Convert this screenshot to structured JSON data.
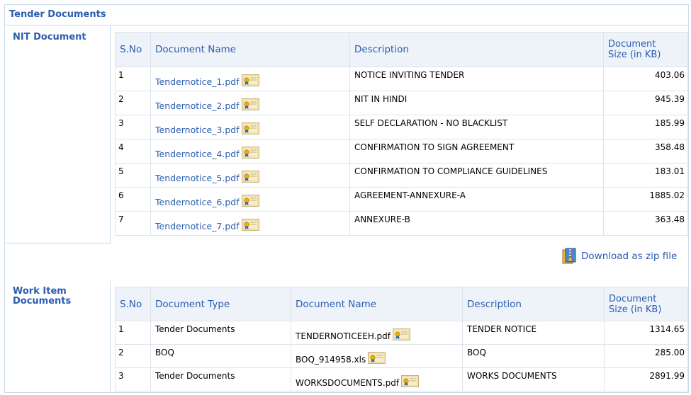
{
  "page_title": "Tender Documents",
  "nit": {
    "section_label": "NIT Document",
    "headers": {
      "sno": "S.No",
      "name": "Document Name",
      "description": "Description",
      "size_line1": "Document",
      "size_line2": "Size (in KB)"
    },
    "rows": [
      {
        "sno": "1",
        "name": "Tendernotice_1.pdf",
        "description": "NOTICE INVITING TENDER",
        "size": "403.06"
      },
      {
        "sno": "2",
        "name": "Tendernotice_2.pdf",
        "description": "NIT IN HINDI",
        "size": "945.39"
      },
      {
        "sno": "3",
        "name": "Tendernotice_3.pdf",
        "description": "SELF DECLARATION - NO BLACKLIST",
        "size": "185.99"
      },
      {
        "sno": "4",
        "name": "Tendernotice_4.pdf",
        "description": "CONFIRMATION TO SIGN AGREEMENT",
        "size": "358.48"
      },
      {
        "sno": "5",
        "name": "Tendernotice_5.pdf",
        "description": "CONFIRMATION TO COMPLIANCE GUIDELINES",
        "size": "183.01"
      },
      {
        "sno": "6",
        "name": "Tendernotice_6.pdf",
        "description": "AGREEMENT-ANNEXURE-A",
        "size": "1885.02"
      },
      {
        "sno": "7",
        "name": "Tendernotice_7.pdf",
        "description": "ANNEXURE-B",
        "size": "363.48"
      }
    ]
  },
  "download_zip_label": "Download as zip file",
  "work": {
    "section_label_line1": "Work Item",
    "section_label_line2": "Documents",
    "headers": {
      "sno": "S.No",
      "type": "Document Type",
      "name": "Document Name",
      "description": "Description",
      "size_line1": "Document",
      "size_line2": "Size (in KB)"
    },
    "rows": [
      {
        "sno": "1",
        "type": "Tender Documents",
        "name": "TENDERNOTICEEH.pdf",
        "description": "TENDER NOTICE",
        "size": "1314.65"
      },
      {
        "sno": "2",
        "type": "BOQ",
        "name": "BOQ_914958.xls",
        "description": "BOQ",
        "size": "285.00"
      },
      {
        "sno": "3",
        "type": "Tender Documents",
        "name": "WORKSDOCUMENTS.pdf",
        "description": "WORKS DOCUMENTS",
        "size": "2891.99"
      }
    ]
  },
  "icons": {
    "signed_document": "certificate-icon",
    "zip_archive": "zip-archive-icon"
  }
}
